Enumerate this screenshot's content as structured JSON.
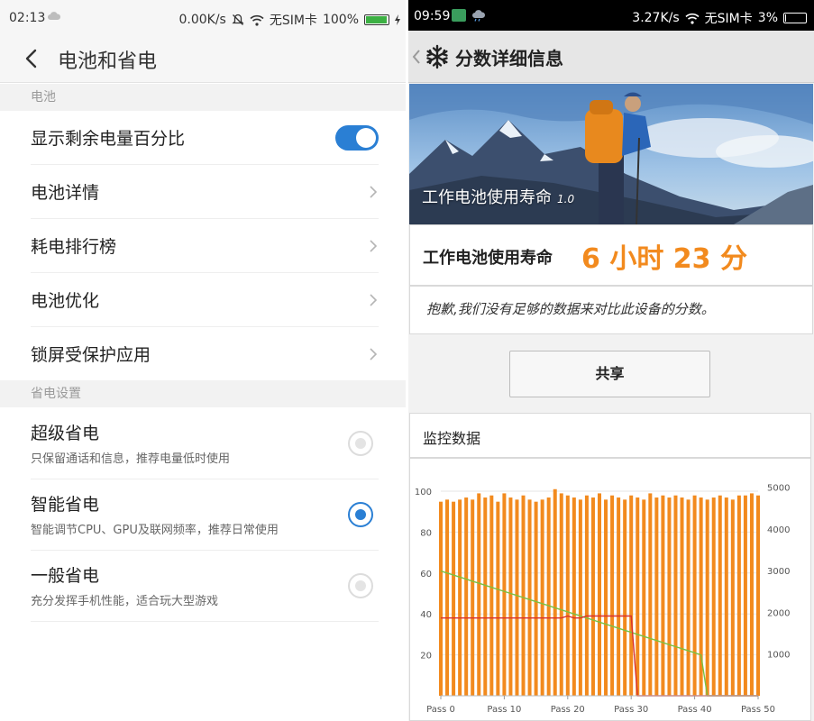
{
  "left": {
    "status": {
      "time": "02:13",
      "speed": "0.00K/s",
      "sim": "无SIM卡",
      "battery": "100%",
      "battery_level": 1.0
    },
    "header": {
      "title": "电池和省电"
    },
    "sections": {
      "battery": "电池",
      "power_save": "省电设置"
    },
    "items": {
      "show_percent": "显示剩余电量百分比",
      "details": "电池详情",
      "ranking": "耗电排行榜",
      "optimize": "电池优化",
      "lock_protect": "锁屏受保护应用"
    },
    "toggle_show_percent_on": true,
    "modes": [
      {
        "title": "超级省电",
        "desc": "只保留通话和信息，推荐电量低时使用",
        "selected": false
      },
      {
        "title": "智能省电",
        "desc": "智能调节CPU、GPU及联网频率，推荐日常使用",
        "selected": true
      },
      {
        "title": "一般省电",
        "desc": "充分发挥手机性能，适合玩大型游戏",
        "selected": false
      }
    ],
    "colors": {
      "accent": "#2a7fd4"
    }
  },
  "right": {
    "status": {
      "time": "09:59",
      "speed": "3.27K/s",
      "sim": "无SIM卡",
      "battery": "3%",
      "battery_level": 0.03
    },
    "header": {
      "title": "分数详细信息"
    },
    "hero": {
      "caption": "工作电池使用寿命",
      "version": "1.0"
    },
    "score": {
      "label": "工作电池使用寿命",
      "value": "6 小时 23 分"
    },
    "sorry_text": "抱歉,我们没有足够的数据来对比此设备的分数。",
    "share_label": "共享",
    "monitor_title": "监控数据",
    "colors": {
      "score": "#f28a1e",
      "bars": "#f28a1e",
      "battery_line": "#7ac143",
      "temp_line": "#d9302c"
    }
  },
  "chart_data": {
    "type": "bar",
    "x_tick_labels": [
      "Pass 0",
      "Pass 10",
      "Pass 20",
      "Pass 30",
      "Pass 40",
      "Pass 50"
    ],
    "left_ticks": [
      "20",
      "40",
      "60",
      "80",
      "100"
    ],
    "right_ticks": [
      "1000",
      "2000",
      "3000",
      "4000",
      "5000"
    ],
    "left_ylim": [
      0,
      100
    ],
    "right_ylim": [
      0,
      5000
    ],
    "series": [
      {
        "axis": "right",
        "kind": "bar",
        "values": [
          4650,
          4700,
          4650,
          4700,
          4750,
          4700,
          4850,
          4750,
          4800,
          4650,
          4850,
          4750,
          4700,
          4800,
          4700,
          4650,
          4700,
          4750,
          4950,
          4850,
          4800,
          4750,
          4700,
          4800,
          4750,
          4850,
          4700,
          4800,
          4750,
          4700,
          4800,
          4750,
          4700,
          4850,
          4750,
          4800,
          4750,
          4800,
          4750,
          4700,
          4800,
          4750,
          4700,
          4750,
          4800,
          4750,
          4700,
          4800,
          4800,
          4850,
          4800
        ]
      },
      {
        "axis": "left",
        "kind": "line",
        "values": [
          61,
          60,
          59,
          58,
          57,
          56,
          55,
          54,
          53,
          52,
          51,
          50,
          49,
          48,
          47,
          46,
          45,
          44,
          43,
          42,
          41,
          40,
          39,
          38,
          37,
          36,
          35,
          34,
          33,
          32,
          31,
          30,
          29,
          28,
          27,
          26,
          25,
          24,
          23,
          22,
          21,
          20,
          0,
          0,
          0,
          0,
          0,
          0,
          0,
          0,
          0
        ]
      },
      {
        "axis": "left",
        "kind": "line",
        "values": [
          38,
          38,
          38,
          38,
          38,
          38,
          38,
          38,
          38,
          38,
          38,
          38,
          38,
          38,
          38,
          38,
          38,
          38,
          38,
          38,
          39,
          38,
          38,
          39,
          39,
          39,
          39,
          39,
          39,
          39,
          39,
          0,
          0,
          0,
          0,
          0,
          0,
          0,
          0,
          0,
          0,
          0,
          0,
          0,
          0,
          0,
          0,
          0,
          0,
          0,
          0
        ]
      }
    ],
    "grid": true
  }
}
